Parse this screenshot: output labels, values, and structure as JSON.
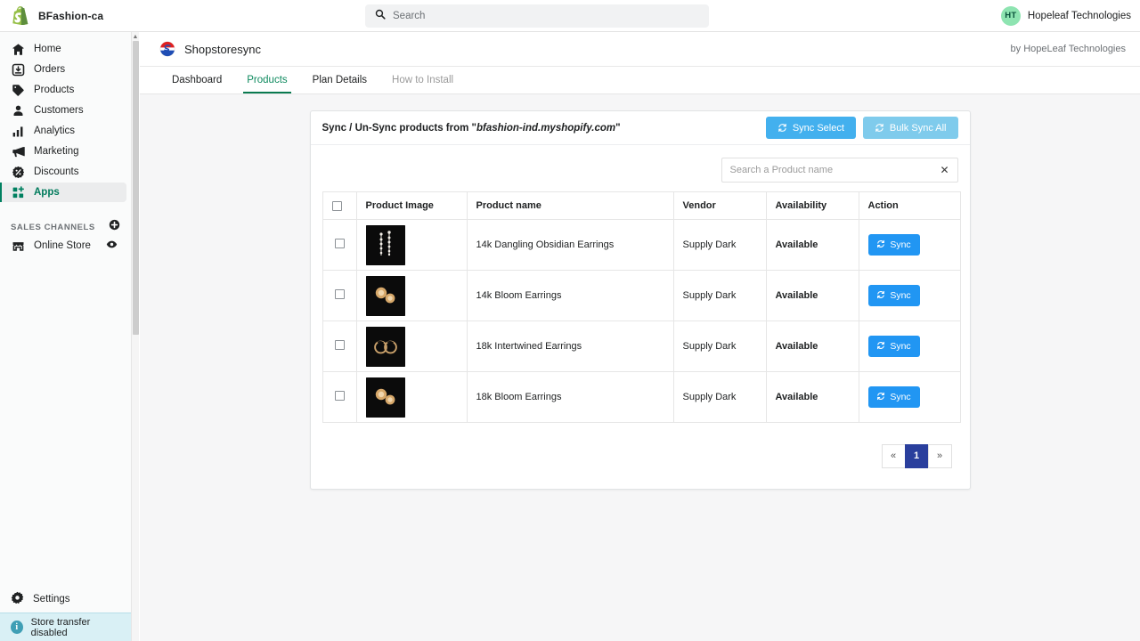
{
  "topbar": {
    "store_name": "BFashion-ca",
    "search_placeholder": "Search",
    "user_initials": "HT",
    "user_name": "Hopeleaf Technologies"
  },
  "sidebar": {
    "items": [
      {
        "label": "Home",
        "icon": "home-icon"
      },
      {
        "label": "Orders",
        "icon": "orders-icon"
      },
      {
        "label": "Products",
        "icon": "products-tag-icon"
      },
      {
        "label": "Customers",
        "icon": "customers-icon"
      },
      {
        "label": "Analytics",
        "icon": "analytics-bars-icon"
      },
      {
        "label": "Marketing",
        "icon": "marketing-megaphone-icon"
      },
      {
        "label": "Discounts",
        "icon": "discounts-icon"
      },
      {
        "label": "Apps",
        "icon": "apps-grid-icon"
      }
    ],
    "section_title": "SALES CHANNELS",
    "add_channel_icon": "plus-circle-icon",
    "channels": [
      {
        "label": "Online Store",
        "icon": "storefront-icon",
        "action_icon": "eye-icon"
      }
    ],
    "settings_label": "Settings",
    "settings_icon": "gear-icon",
    "banner_text": "Store transfer disabled",
    "banner_icon": "info-icon"
  },
  "app": {
    "name": "Shopstoresync",
    "logo_icon": "shopstoresync-logo-icon",
    "by_line": "by HopeLeaf Technologies",
    "tabs": [
      {
        "label": "Dashboard"
      },
      {
        "label": "Products"
      },
      {
        "label": "Plan Details"
      },
      {
        "label": "How to Install"
      }
    ]
  },
  "card": {
    "title_prefix": "Sync / Un-Sync products from \"",
    "store_domain": "bfashion-ind.myshopify.com",
    "title_suffix": "\"",
    "sync_select_label": "Sync Select",
    "bulk_sync_label": "Bulk Sync All",
    "search_placeholder": "Search a Product name",
    "search_value": "",
    "clear_icon": "close-x-icon"
  },
  "table": {
    "columns": [
      "",
      "Product Image",
      "Product name",
      "Vendor",
      "Availability",
      "Action"
    ],
    "rows": [
      {
        "name": "14k Dangling Obsidian Earrings",
        "vendor": "Supply Dark",
        "availability": "Available",
        "action": "Sync",
        "thumb": "dangling-earrings"
      },
      {
        "name": "14k Bloom Earrings",
        "vendor": "Supply Dark",
        "availability": "Available",
        "action": "Sync",
        "thumb": "bloom-earrings"
      },
      {
        "name": "18k Intertwined Earrings",
        "vendor": "Supply Dark",
        "availability": "Available",
        "action": "Sync",
        "thumb": "hoop-earrings"
      },
      {
        "name": "18k Bloom Earrings",
        "vendor": "Supply Dark",
        "availability": "Available",
        "action": "Sync",
        "thumb": "bloom-earrings"
      }
    ]
  },
  "pagination": {
    "prev_label": "«",
    "current_page": "1",
    "next_label": "»"
  },
  "colors": {
    "accent_green": "#008060",
    "sync_blue": "#2196f3",
    "header_blue": "#43b0ee",
    "header_blue_faded": "#7fcbec",
    "pager_navy": "#2a3f9d",
    "banner_blue": "#d9f0f5"
  }
}
